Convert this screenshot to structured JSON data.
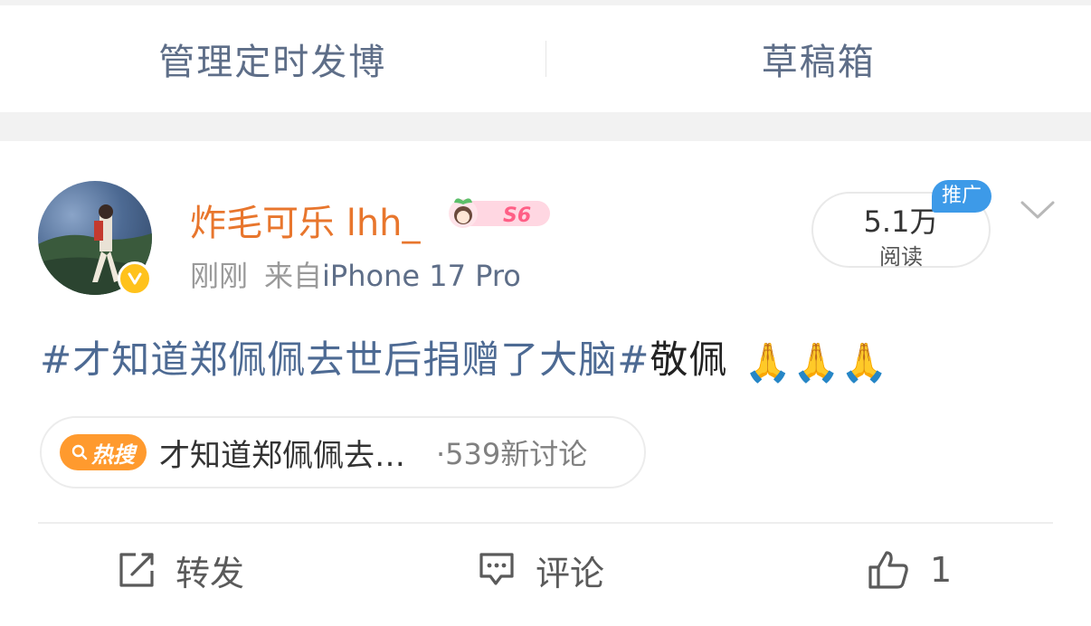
{
  "tabs": {
    "scheduled": "管理定时发博",
    "drafts": "草稿箱"
  },
  "post": {
    "username": "炸毛可乐 lhh_",
    "level": "S6",
    "time": "刚刚",
    "source_prefix": "来自",
    "device": "iPhone 17 Pro",
    "reads": "5.1万",
    "reads_label": "阅读",
    "promo_tag": "推广",
    "topic": "#才知道郑佩佩去世后捐赠了大脑#",
    "text_after_topic": "敬佩",
    "emojis": "🙏🙏🙏",
    "hot_badge": "热搜",
    "hot_title": "才知道郑佩佩去…",
    "hot_count": "·539新讨论"
  },
  "actions": {
    "repost": "转发",
    "comment": "评论",
    "like_count": "1"
  },
  "colors": {
    "link": "#4d6a93",
    "username": "#e8762d",
    "hot": "#ff9a2e",
    "promo": "#3d9ae8"
  }
}
